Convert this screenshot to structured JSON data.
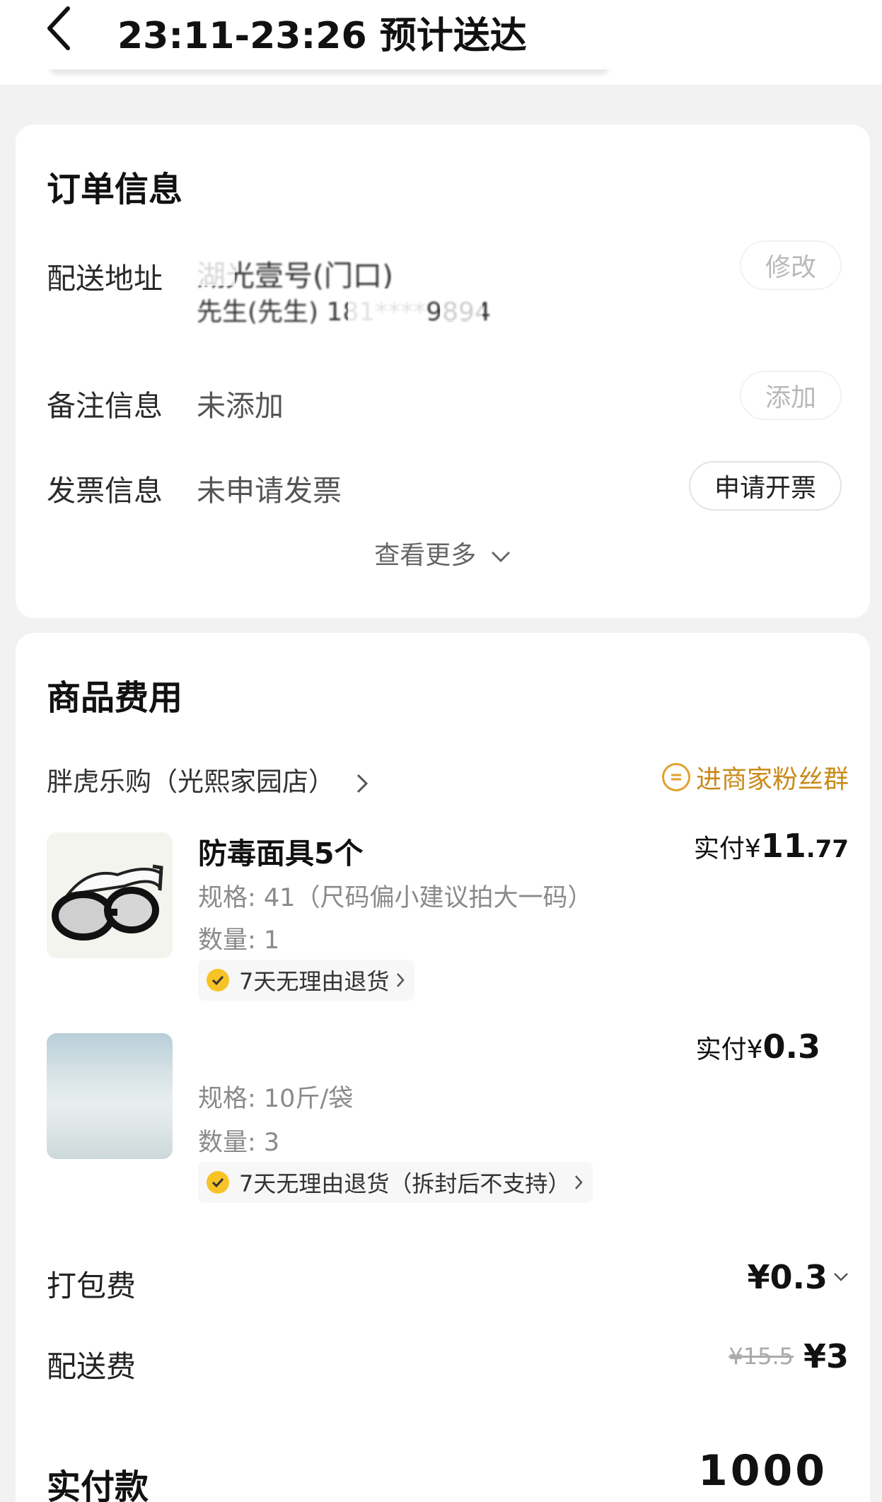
{
  "header": {
    "title": "23:11-23:26 预计送达"
  },
  "order_info": {
    "title": "订单信息",
    "address": {
      "label": "配送地址",
      "line1": "湖光壹号(门口)",
      "line2": "先生(先生) 181****9894",
      "action": "修改"
    },
    "note": {
      "label": "备注信息",
      "value": "未添加",
      "action": "添加"
    },
    "invoice": {
      "label": "发票信息",
      "value": "未申请发票",
      "action": "申请开票"
    },
    "see_more": "查看更多"
  },
  "goods": {
    "title": "商品费用",
    "store": "胖虎乐购（光熙家园店）",
    "fans_group": "进商家粉丝群",
    "items": [
      {
        "name": "防毒面具5个",
        "spec": "规格: 41（尺码偏小建议拍大一码）",
        "qty": "数量: 1",
        "return_policy": "7天无理由退货",
        "price_prefix": "实付¥",
        "price_int": "11",
        "price_dec": ".77"
      },
      {
        "name": "",
        "spec": "规格: 10斤/袋",
        "qty": "数量: 3",
        "return_policy": "7天无理由退货（拆封后不支持）",
        "price_prefix": "实付¥",
        "price_int": "0.3",
        "price_dec": ""
      }
    ],
    "packing_fee": {
      "label": "打包费",
      "value": "¥0.3"
    },
    "delivery_fee": {
      "label": "配送费",
      "original": "¥15.5",
      "value": "¥3"
    },
    "total": {
      "label": "实付款",
      "value": "1000"
    }
  },
  "icons": {
    "back": "chevron-left-icon",
    "expand": "chevron-down-icon",
    "store_arrow": "chevron-right-icon",
    "fans": "chat-group-icon",
    "check": "check-badge-icon"
  },
  "colors": {
    "accent": "#f7c326",
    "fans_link": "#c98a1a",
    "background": "#f2f2f2"
  }
}
